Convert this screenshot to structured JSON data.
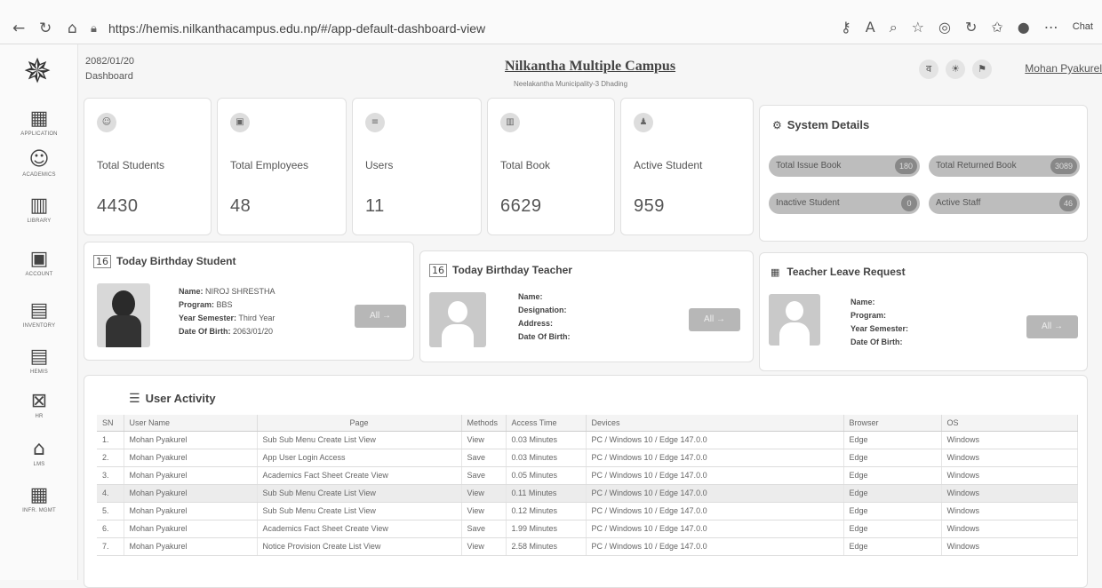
{
  "browser": {
    "url": "https://hemis.nilkanthacampus.edu.np/#/app-default-dashboard-view",
    "chat_label": "Chat"
  },
  "sidebar": {
    "items": [
      {
        "label": "APPLICATION",
        "icon": "grid-icon"
      },
      {
        "label": "ACADEMICS",
        "icon": "graduation-icon"
      },
      {
        "label": "LIBRARY",
        "icon": "library-icon"
      },
      {
        "label": "ACCOUNT",
        "icon": "account-icon"
      },
      {
        "label": "INVENTORY",
        "icon": "inventory-icon"
      },
      {
        "label": "HEMIS",
        "icon": "hemis-icon"
      },
      {
        "label": "HR",
        "icon": "hr-icon"
      },
      {
        "label": "LMS",
        "icon": "lms-icon"
      },
      {
        "label": "INFR. MGMT",
        "icon": "infrastructure-icon"
      }
    ]
  },
  "header": {
    "date": "2082/01/20",
    "breadcrumb": "Dashboard",
    "campus_name": "Nilkantha Multiple Campus",
    "campus_subtitle": "Neelakantha Municipality-3 Dhading",
    "user_name": "Mohan Pyakurel"
  },
  "stats": [
    {
      "label": "Total Students",
      "value": "4430"
    },
    {
      "label": "Total Employees",
      "value": "48"
    },
    {
      "label": "Users",
      "value": "11"
    },
    {
      "label": "Total Book",
      "value": "6629"
    },
    {
      "label": "Active Student",
      "value": "959"
    }
  ],
  "system_details": {
    "title": "System Details",
    "items": [
      {
        "label": "Total Issue Book",
        "value": "180"
      },
      {
        "label": "Total Returned Book",
        "value": "3089"
      },
      {
        "label": "Inactive Student",
        "value": "0"
      },
      {
        "label": "Active Staff",
        "value": "46"
      }
    ]
  },
  "birthday_student": {
    "title": "Today Birthday Student",
    "name_label": "Name:",
    "name": "NIROJ SHRESTHA",
    "program_label": "Program:",
    "program": "BBS",
    "year_label": "Year Semester:",
    "year": "Third Year",
    "dob_label": "Date Of Birth:",
    "dob": "2063/01/20",
    "all_label": "All →"
  },
  "birthday_teacher": {
    "title": "Today Birthday Teacher",
    "name_label": "Name:",
    "designation_label": "Designation:",
    "address_label": "Address:",
    "dob_label": "Date Of Birth:",
    "all_label": "All →"
  },
  "leave_request": {
    "title": "Teacher Leave Request",
    "name_label": "Name:",
    "program_label": "Program:",
    "year_label": "Year Semester:",
    "dob_label": "Date Of Birth:",
    "all_label": "All →"
  },
  "user_activity": {
    "title": "User Activity",
    "columns": [
      "SN",
      "User Name",
      "Page",
      "Methods",
      "Access Time",
      "Devices",
      "Browser",
      "OS"
    ],
    "rows": [
      [
        "1.",
        "Mohan Pyakurel",
        "Sub Sub Menu Create List View",
        "View",
        "0.03 Minutes",
        "PC / Windows 10 / Edge 147.0.0",
        "Edge",
        "Windows"
      ],
      [
        "2.",
        "Mohan Pyakurel",
        "App User Login Access",
        "Save",
        "0.03 Minutes",
        "PC / Windows 10 / Edge 147.0.0",
        "Edge",
        "Windows"
      ],
      [
        "3.",
        "Mohan Pyakurel",
        "Academics Fact Sheet Create View",
        "Save",
        "0.05 Minutes",
        "PC / Windows 10 / Edge 147.0.0",
        "Edge",
        "Windows"
      ],
      [
        "4.",
        "Mohan Pyakurel",
        "Sub Sub Menu Create List View",
        "View",
        "0.11 Minutes",
        "PC / Windows 10 / Edge 147.0.0",
        "Edge",
        "Windows"
      ],
      [
        "5.",
        "Mohan Pyakurel",
        "Sub Sub Menu Create List View",
        "View",
        "0.12 Minutes",
        "PC / Windows 10 / Edge 147.0.0",
        "Edge",
        "Windows"
      ],
      [
        "6.",
        "Mohan Pyakurel",
        "Academics Fact Sheet Create View",
        "Save",
        "1.99 Minutes",
        "PC / Windows 10 / Edge 147.0.0",
        "Edge",
        "Windows"
      ],
      [
        "7.",
        "Mohan Pyakurel",
        "Notice Provision Create List View",
        "View",
        "2.58 Minutes",
        "PC / Windows 10 / Edge 147.0.0",
        "Edge",
        "Windows"
      ]
    ]
  }
}
